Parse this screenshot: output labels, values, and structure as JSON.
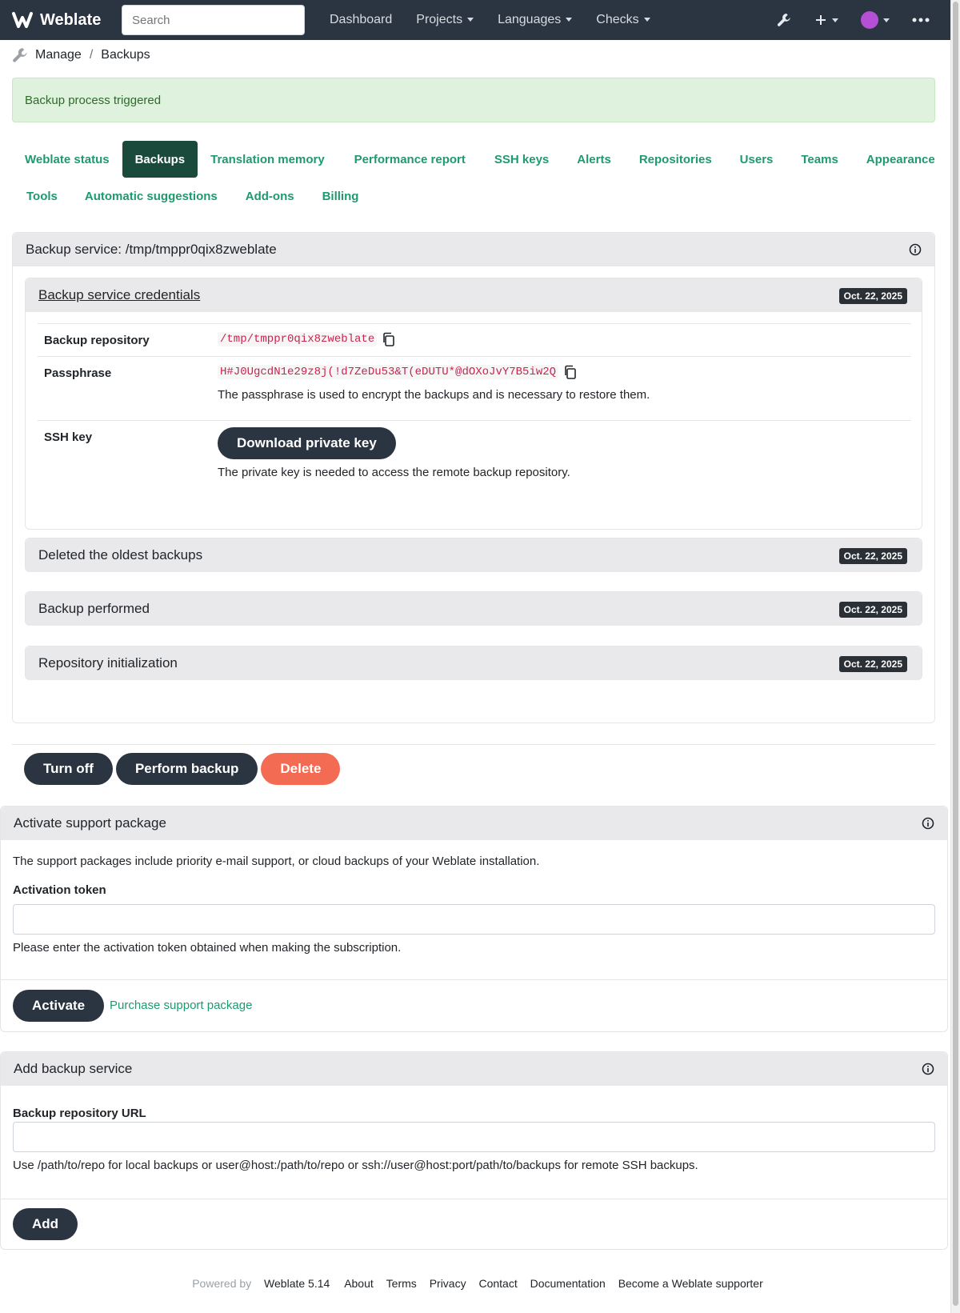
{
  "navbar": {
    "brand": "Weblate",
    "search_placeholder": "Search",
    "links": [
      "Dashboard",
      "Projects",
      "Languages",
      "Checks"
    ]
  },
  "breadcrumb": {
    "items": [
      "Manage",
      "Backups"
    ]
  },
  "alert": {
    "text": "Backup process triggered"
  },
  "tabs": {
    "row1": [
      "Weblate status",
      "Backups",
      "Translation memory",
      "Performance report",
      "SSH keys",
      "Alerts",
      "Repositories",
      "Users",
      "Teams",
      "Appearance"
    ],
    "row2": [
      "Tools",
      "Automatic suggestions",
      "Add-ons",
      "Billing"
    ],
    "active": "Backups"
  },
  "backup_service": {
    "title": "Backup service: /tmp/tmppr0qix8zweblate",
    "credentials": {
      "title": "Backup service credentials",
      "date": "Oct. 22, 2025",
      "repository_label": "Backup repository",
      "repository_value": "/tmp/tmppr0qix8zweblate",
      "passphrase_label": "Passphrase",
      "passphrase_value": "H#J0UgcdN1e29z8j(!d7ZeDu53&T(eDUTU*@dOXoJvY7B5iw2Q",
      "passphrase_help": "The passphrase is used to encrypt the backups and is necessary to restore them.",
      "ssh_label": "SSH key",
      "download_button": "Download private key",
      "ssh_help": "The private key is needed to access the remote backup repository."
    },
    "events": [
      {
        "title": "Deleted the oldest backups",
        "date": "Oct. 22, 2025"
      },
      {
        "title": "Backup performed",
        "date": "Oct. 22, 2025"
      },
      {
        "title": "Repository initialization",
        "date": "Oct. 22, 2025"
      }
    ],
    "buttons": {
      "turn_off": "Turn off",
      "perform": "Perform backup",
      "delete": "Delete"
    }
  },
  "support": {
    "title": "Activate support package",
    "description": "The support packages include priority e-mail support, or cloud backups of your Weblate installation.",
    "token_label": "Activation token",
    "token_help": "Please enter the activation token obtained when making the subscription.",
    "activate_button": "Activate",
    "purchase_link": "Purchase support package"
  },
  "add_backup": {
    "title": "Add backup service",
    "url_label": "Backup repository URL",
    "url_help": "Use /path/to/repo for local backups or user@host:/path/to/repo or ssh://user@host:port/path/to/backups for remote SSH backups.",
    "add_button": "Add"
  },
  "footer": {
    "powered_by": "Powered by",
    "version": "Weblate 5.14",
    "links": [
      "About",
      "Terms",
      "Privacy",
      "Contact",
      "Documentation",
      "Become a Weblate supporter"
    ]
  },
  "colors": {
    "navbar": "#2b3441",
    "accent": "#1f9a6e",
    "active_tab": "#1a4a3b",
    "danger": "#f26b52",
    "alert_bg": "#dff2dd"
  }
}
